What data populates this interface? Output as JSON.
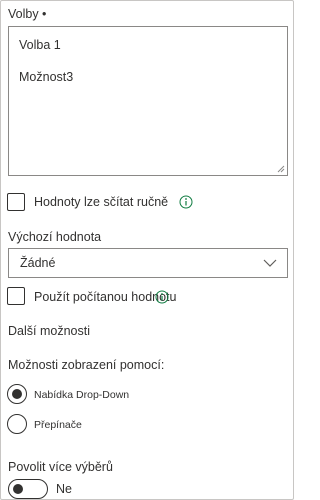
{
  "choices": {
    "label": "Volby •",
    "items": [
      "Volba 1",
      "Možnost3"
    ]
  },
  "manual_values": {
    "label": "Hodnoty lze sčítat ručně",
    "checked": false,
    "info_icon": "info-icon"
  },
  "default_value": {
    "label": "Výchozí hodnota",
    "selected": "Žádné"
  },
  "calculated_value": {
    "label": "Použít počítanou hodnotu",
    "checked": false,
    "info_icon": "info-icon"
  },
  "more_options": {
    "label": "Další možnosti"
  },
  "display_using": {
    "label": "Možnosti zobrazení pomocí:",
    "options": [
      {
        "label": "Nabídka Drop-Down",
        "selected": true
      },
      {
        "label": "Přepínače",
        "selected": false
      }
    ]
  },
  "multi_select": {
    "label": "Povolit více výběrů",
    "state_label": "Ne",
    "on": false
  },
  "colors": {
    "text": "#323130",
    "border": "#8a8886",
    "info_accent": "#107c41"
  }
}
